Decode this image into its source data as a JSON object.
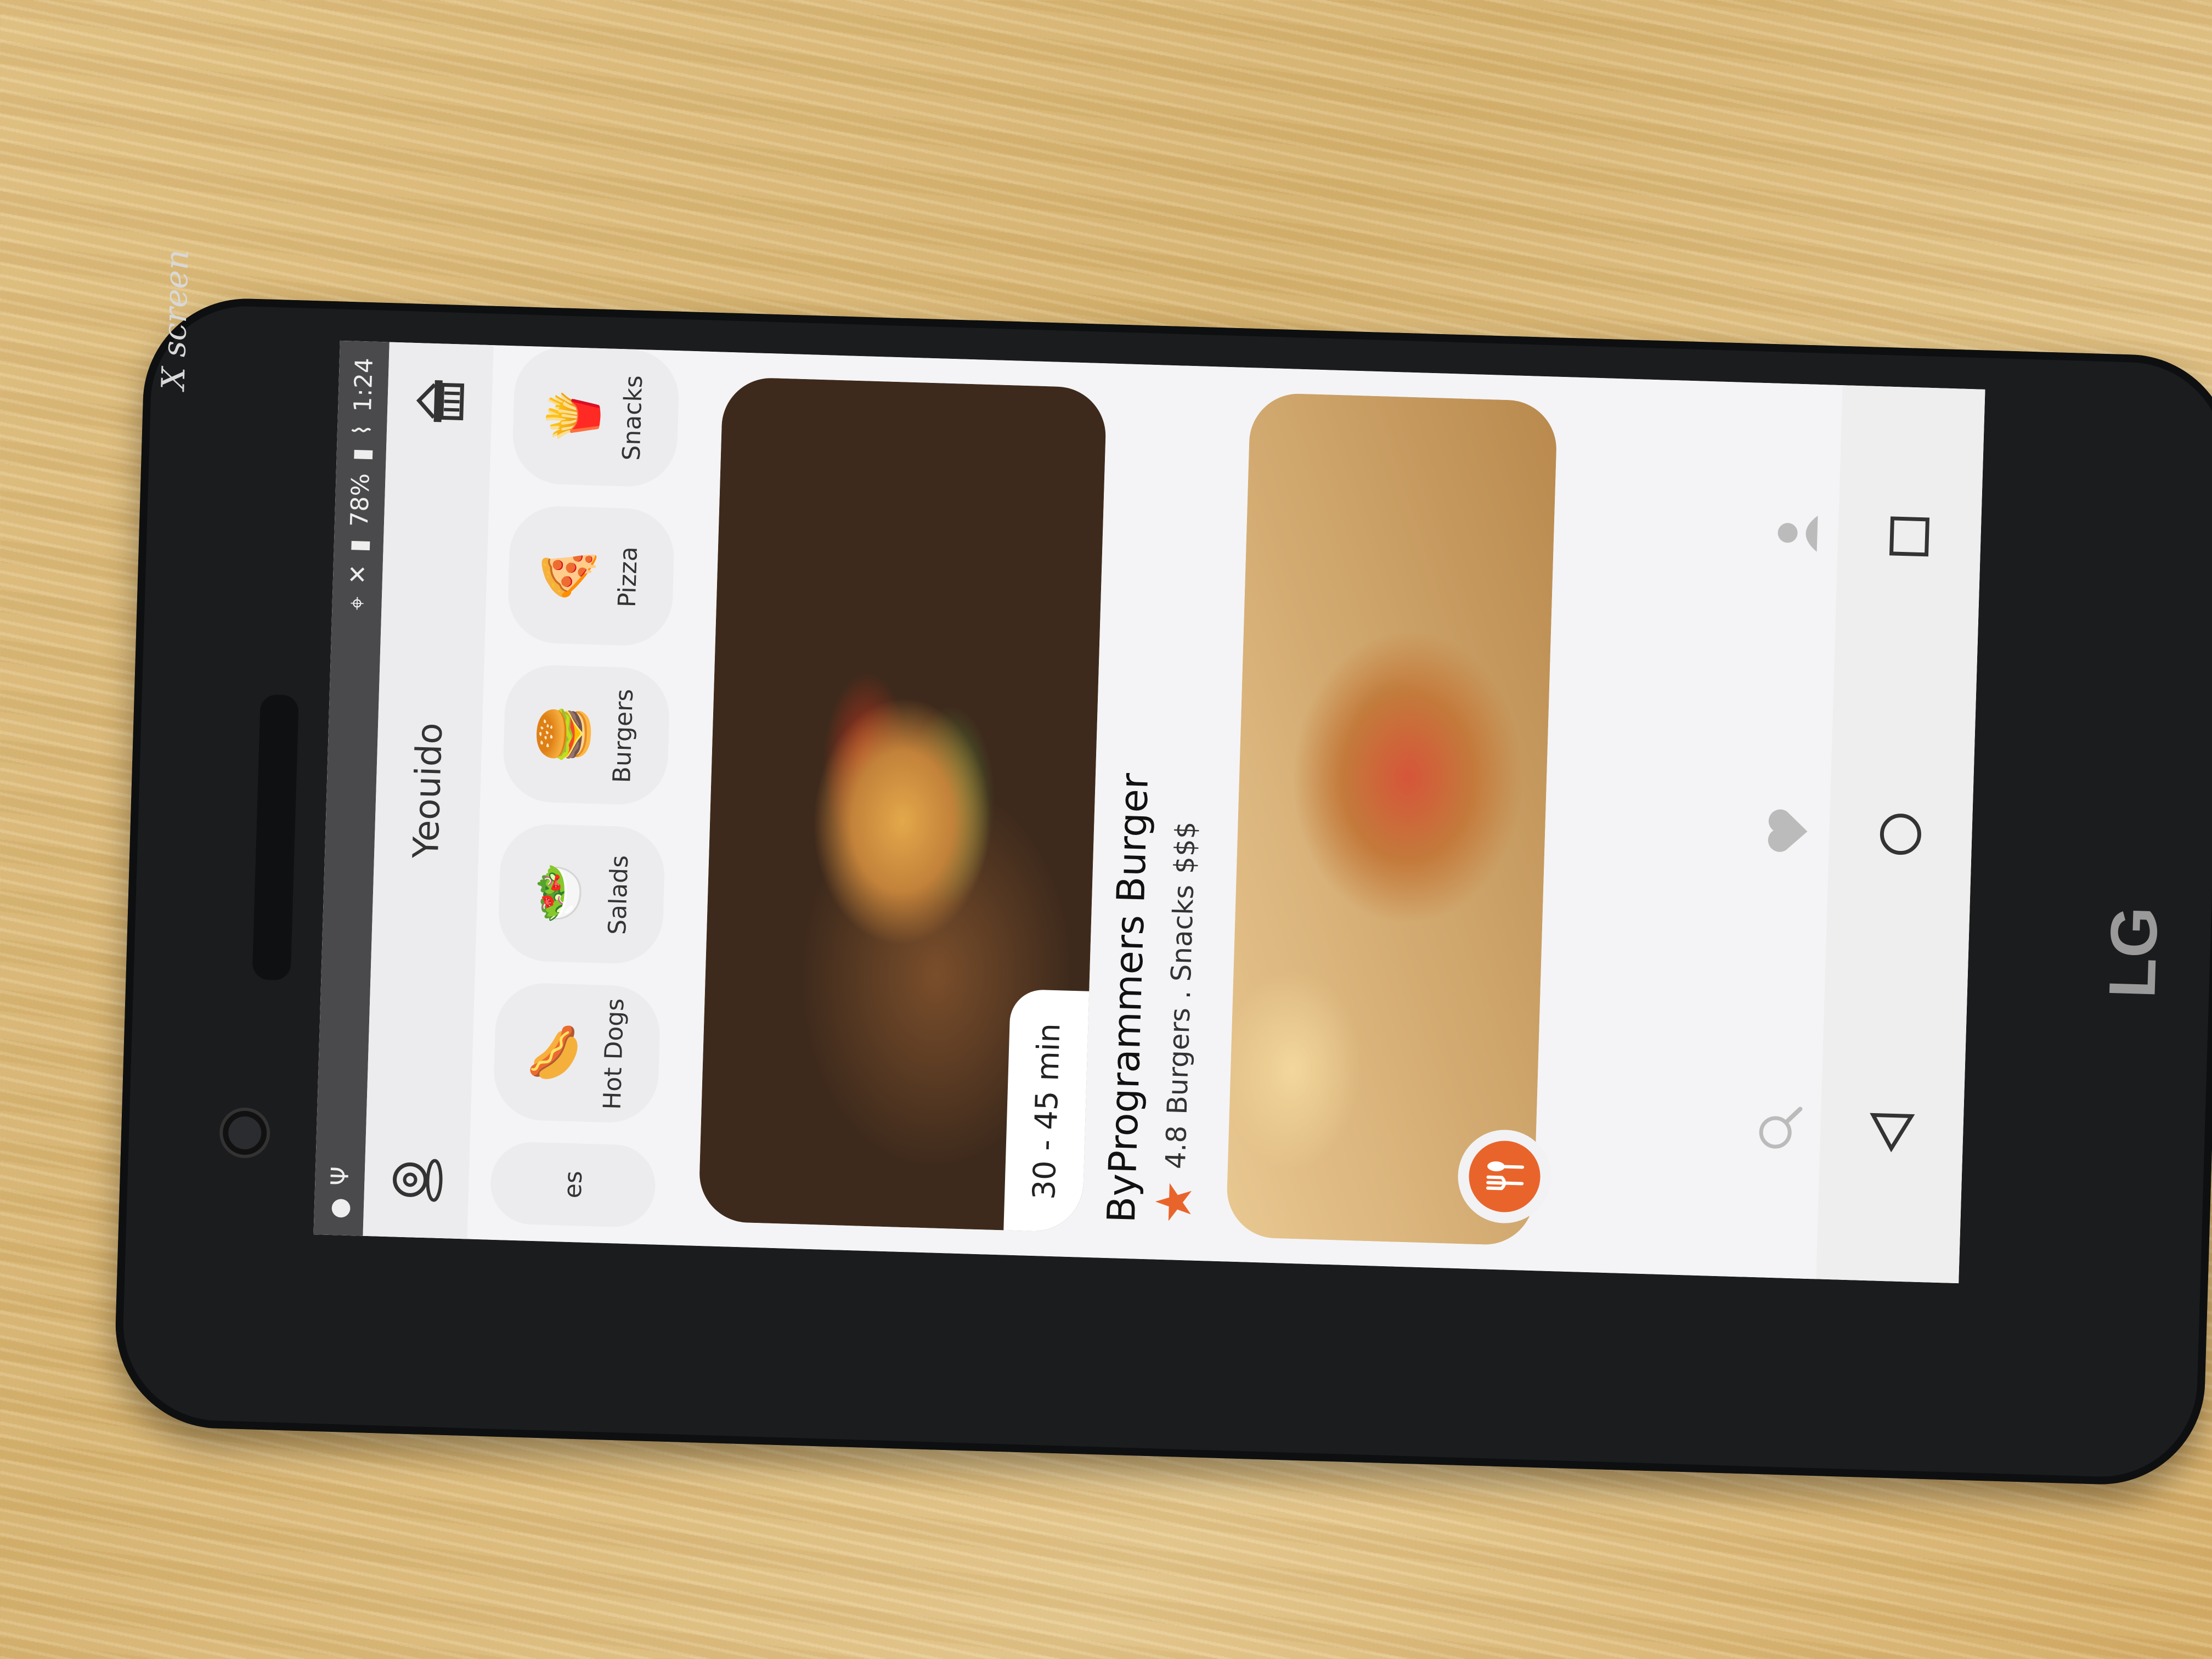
{
  "device": {
    "brand_label": "X screen",
    "logo": "LG"
  },
  "status_bar": {
    "battery": "78%",
    "time": "1:24"
  },
  "header": {
    "location": "Yeouido",
    "left_icon": "location-pin-icon",
    "right_icon": "basket-icon"
  },
  "categories": [
    {
      "label": "es",
      "icon": "partial-icon"
    },
    {
      "label": "Hot Dogs",
      "icon": "🌭"
    },
    {
      "label": "Salads",
      "icon": "🥗"
    },
    {
      "label": "Burgers",
      "icon": "🍔"
    },
    {
      "label": "Pizza",
      "icon": "🍕"
    },
    {
      "label": "Snacks",
      "icon": "🍟"
    }
  ],
  "restaurants": [
    {
      "time": "30 - 45 min",
      "name": "ByProgrammers Burger",
      "rating": "4.8",
      "tags": "Burgers . Snacks",
      "price": "$$$"
    }
  ],
  "tabs": [
    "restaurant-icon",
    "search-icon",
    "heart-icon",
    "user-icon"
  ],
  "colors": {
    "accent": "#e9642b"
  }
}
